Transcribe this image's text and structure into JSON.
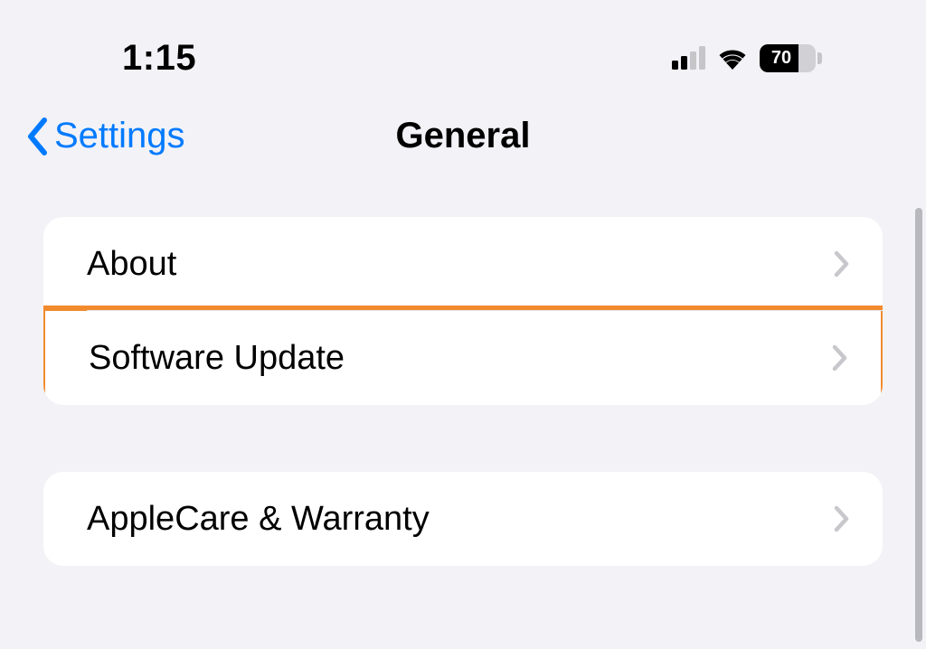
{
  "status": {
    "time": "1:15",
    "battery_pct": "70"
  },
  "nav": {
    "back_label": "Settings",
    "title": "General"
  },
  "groups": [
    {
      "rows": [
        {
          "label": "About",
          "highlight": false
        },
        {
          "label": "Software Update",
          "highlight": true
        }
      ]
    },
    {
      "rows": [
        {
          "label": "AppleCare & Warranty",
          "highlight": false
        }
      ]
    }
  ]
}
